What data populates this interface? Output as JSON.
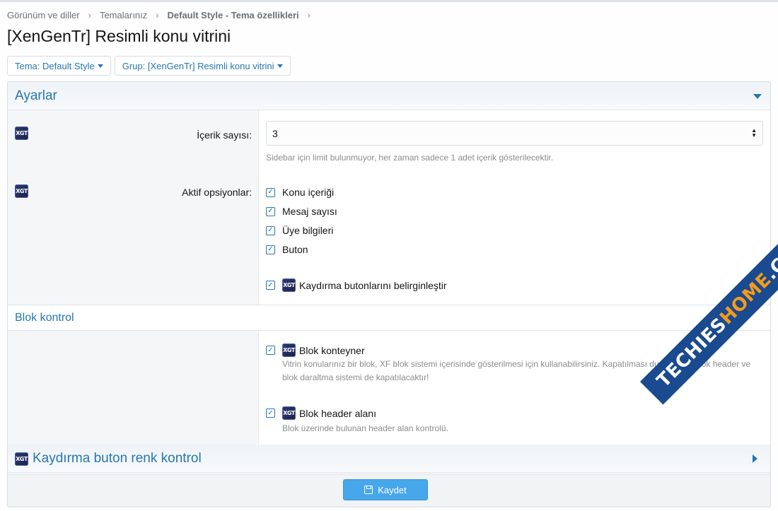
{
  "breadcrumb": [
    "Görünüm ve diller",
    "Temalarınız",
    "Default Style - Tema özellikleri"
  ],
  "page_title": "[XenGenTr] Resimli konu vitrini",
  "filters": {
    "style": "Tema: Default Style",
    "group": "Grup: [XenGenTr] Resimli konu vitrini"
  },
  "settings_section": {
    "title": "Ayarlar",
    "content_count": {
      "label": "İçerik sayısı:",
      "value": "3",
      "hint": "Sidebar için limit bulunmuyor, her zaman sadece 1 adet içerik gösterilecektir."
    },
    "active_options": {
      "label": "Aktif opsiyonlar:",
      "items": [
        "Konu içeriği",
        "Mesaj sayısı",
        "Üye bilgileri",
        "Buton"
      ],
      "scroll_buttons": "Kaydırma butonlarını belirginleştir"
    }
  },
  "block_control": {
    "title": "Blok kontrol",
    "container": {
      "label": "Blok konteyner",
      "hint": "Vitrin konularınız bir blok, XF blok sistemi içerisinde gösterilmesi için kullanabilirsiniz. Kapatılması durumunda blok header ve blok daraltma sistemi de kapatılacaktır!"
    },
    "header": {
      "label": "Blok header alanı",
      "hint": "Blok üzerinde bulunan header alan kontrolü."
    }
  },
  "scroll_color_section": {
    "title": "Kaydırma buton renk kontrol"
  },
  "footer": {
    "save_label": "Kaydet"
  },
  "badge_text": "XGT",
  "check_mark": "✓",
  "breadcrumb_sep": "›",
  "watermark": {
    "part1": "TECHIES",
    "part2": "HOME",
    "part3": ".COM"
  },
  "colors": {
    "accent": "#2577b1",
    "save_button": "#47a7eb",
    "muted_text": "#8c8c8c"
  }
}
